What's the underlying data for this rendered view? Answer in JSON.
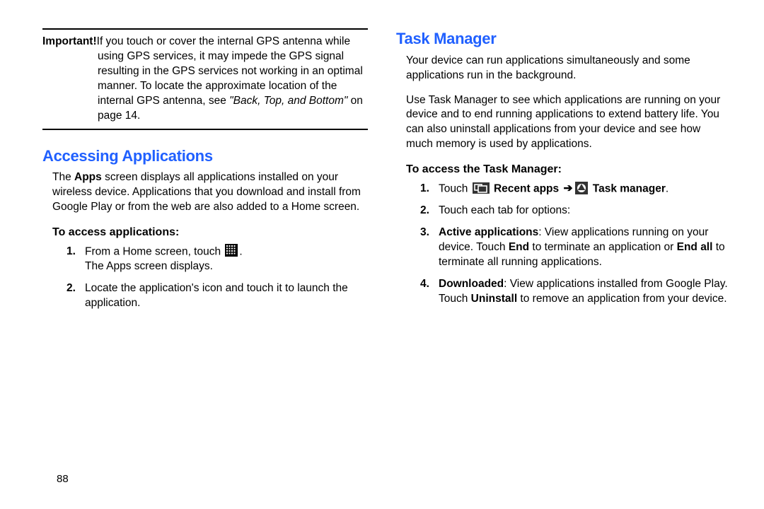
{
  "pageNumber": "88",
  "left": {
    "importantLabel": "Important!",
    "importantBody1": "If you touch or cover the internal GPS antenna while using GPS services, it may impede the GPS signal resulting in the GPS services not working in an optimal manner. To locate the approximate location of the internal GPS antenna, see ",
    "importantRef": "\"Back, Top, and Bottom\"",
    "importantBody2": " on page 14.",
    "heading": "Accessing Applications",
    "para1a": "The ",
    "para1Bold": "Apps",
    "para1b": " screen displays all applications installed on your wireless device. Applications that you download and install from Google Play or from the web are also added to a Home screen.",
    "subhead": "To access applications:",
    "step1a": "From a Home screen, touch ",
    "step1dot": ".",
    "step1line2": "The Apps screen displays.",
    "step2": "Locate the application's icon and touch it to launch the application."
  },
  "right": {
    "heading": "Task Manager",
    "para1": "Your device can run applications simultaneously and some applications run in the background.",
    "para2": "Use Task Manager to see which applications are running on your device and to end running applications to extend battery life. You can also uninstall applications from your device and see how much memory is used by applications.",
    "subhead": "To access the Task Manager:",
    "step1_touch": "Touch ",
    "step1_recent": " Recent apps ",
    "step1_taskmgr": " Task manager",
    "step1_dot": ".",
    "step2": "Touch each tab for options:",
    "step3_bold": "Active applications",
    "step3a": ": View applications running on your device. Touch ",
    "step3_end": "End",
    "step3b": " to terminate an application or ",
    "step3_endall": "End all",
    "step3c": " to terminate all running applications.",
    "step4_bold": "Downloaded",
    "step4a": ": View applications installed from Google Play. Touch ",
    "step4_uninstall": "Uninstall",
    "step4b": " to remove an application from your device."
  }
}
